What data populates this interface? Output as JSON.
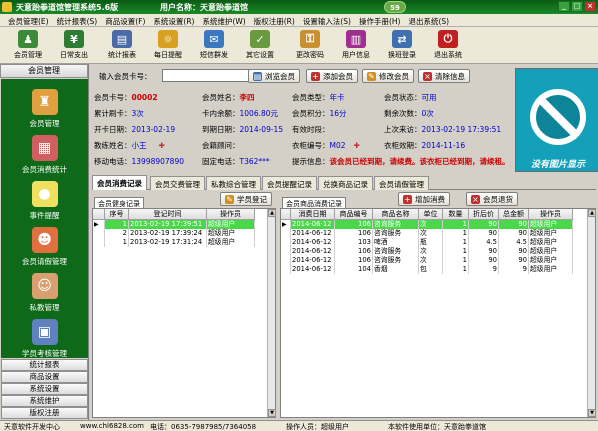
{
  "titlebar": {
    "title": "天意跆拳道馆管理系统5.6版",
    "user_label": "用户名称：天意跆拳道馆",
    "badge": "59",
    "min": "_",
    "max": "□",
    "close": "×"
  },
  "menu": [
    "会员管理(E)",
    "统计报表(S)",
    "商品设置(F)",
    "系统设置(R)",
    "系统维护(W)",
    "版权注册(R)",
    "设置输入法(S)",
    "操作手册(H)",
    "退出系统(S)"
  ],
  "toolbar": [
    {
      "label": "会员管理",
      "icon": "members-icon",
      "glyph": "♟",
      "color": "#3a8a3a"
    },
    {
      "label": "日常支出",
      "icon": "expense-icon",
      "glyph": "¥",
      "color": "#2e7d32"
    },
    {
      "label": "统计报表",
      "icon": "report-icon",
      "glyph": "▤",
      "color": "#4a6aa8"
    },
    {
      "label": "每日提醒",
      "icon": "reminder-icon",
      "glyph": "☼",
      "color": "#d8a020"
    },
    {
      "label": "短信群发",
      "icon": "sms-icon",
      "glyph": "✉",
      "color": "#3a78c0"
    },
    {
      "label": "其它设置",
      "icon": "settings-icon",
      "glyph": "✓",
      "color": "#6a9a40"
    },
    {
      "label": "更改密码",
      "icon": "password-icon",
      "glyph": "⚿",
      "color": "#c89030"
    },
    {
      "label": "用户信息",
      "icon": "user-info-icon",
      "glyph": "▥",
      "color": "#a03090"
    },
    {
      "label": "换班登录",
      "icon": "shift-login-icon",
      "glyph": "⇄",
      "color": "#4070b0"
    },
    {
      "label": "退出系统",
      "icon": "exit-icon",
      "glyph": "⏻",
      "color": "#c02020"
    }
  ],
  "sidebar": {
    "header": "会员管理",
    "items": [
      {
        "label": "会员管理",
        "icon": "member-manage-icon",
        "glyph": "♜",
        "color": "#e0a040"
      },
      {
        "label": "会员消费统计",
        "icon": "consume-stats-icon",
        "glyph": "▦",
        "color": "#d06060"
      },
      {
        "label": "事件提醒",
        "icon": "event-reminder-icon",
        "glyph": "●",
        "color": "#f0e060"
      },
      {
        "label": "会员请假管理",
        "icon": "leave-manage-icon",
        "glyph": "☻",
        "color": "#e07040"
      },
      {
        "label": "私教管理",
        "icon": "coach-manage-icon",
        "glyph": "☺",
        "color": "#d8a070"
      },
      {
        "label": "学员考核管理",
        "icon": "exam-manage-icon",
        "glyph": "▣",
        "color": "#6080c0"
      }
    ],
    "categories": [
      "统计报表",
      "商品设置",
      "系统设置",
      "系统维护",
      "版权注册"
    ]
  },
  "search": {
    "label": "输入会员卡号：",
    "value": "",
    "buttons": [
      {
        "label": "浏览会员",
        "icon": "browse-icon",
        "glyph": "▤",
        "color": "#3a70b0"
      },
      {
        "label": "添加会员",
        "icon": "add-icon",
        "glyph": "+",
        "color": "#c03030"
      },
      {
        "label": "修改会员",
        "icon": "edit-icon",
        "glyph": "✎",
        "color": "#d09020"
      },
      {
        "label": "清除信息",
        "icon": "clear-icon",
        "glyph": "×",
        "color": "#c03030"
      }
    ]
  },
  "member": {
    "rows": [
      [
        {
          "k": "会员卡号：",
          "v": "00002",
          "style": "red"
        },
        {
          "k": "会员姓名：",
          "v": "李四",
          "style": "red"
        },
        {
          "k": "会员类型：",
          "v": "年卡",
          "style": ""
        },
        {
          "k": "会员状态：",
          "v": "可用",
          "style": ""
        }
      ],
      [
        {
          "k": "累计刷卡：",
          "v": "3次",
          "style": ""
        },
        {
          "k": "卡内余额：",
          "v": "1006.80元",
          "style": ""
        },
        {
          "k": "会员积分：",
          "v": "16分",
          "style": ""
        },
        {
          "k": "剩余次数：",
          "v": "0次",
          "style": ""
        }
      ],
      [
        {
          "k": "开卡日期：",
          "v": "2013-02-19",
          "style": ""
        },
        {
          "k": "到期日期：",
          "v": "2014-09-15",
          "style": ""
        },
        {
          "k": "有效时段：",
          "v": "",
          "style": ""
        },
        {
          "k": "上次来访：",
          "v": "2013-02-19 17:39:51",
          "style": ""
        }
      ],
      [
        {
          "k": "教练姓名：",
          "v": "小王",
          "style": ""
        },
        {
          "k": "会籍顾问：",
          "v": "",
          "style": ""
        },
        {
          "k": "衣柜编号：",
          "v": "M02",
          "style": ""
        },
        {
          "k": "衣柜效期：",
          "v": "2014-11-16",
          "style": ""
        }
      ],
      [
        {
          "k": "移动电话：",
          "v": "13998907890",
          "style": ""
        },
        {
          "k": "固定电话：",
          "v": "T362***",
          "style": ""
        },
        {
          "k": "提示信息：",
          "v": "该会员已经到期，请续费。该衣柜已经到期，请续租。",
          "style": "red"
        }
      ]
    ]
  },
  "photo": {
    "text": "没有图片显示",
    "icon": "no-image-icon"
  },
  "tabs": [
    "会员消费记录",
    "会员交费管理",
    "私教综合管理",
    "会员提醒记录",
    "兑换商品记录",
    "会员请假管理"
  ],
  "left_panel": {
    "tab": "会员健身记录",
    "button": "学员登记",
    "columns": [
      "序号",
      "登记时间",
      "操作员"
    ],
    "rows": [
      [
        "1",
        "2013-02-19 17:39:51",
        "超级用户"
      ],
      [
        "2",
        "2013-02-19 17:39:24",
        "超级用户"
      ],
      [
        "1",
        "2013-02-19 17:31:24",
        "超级用户"
      ]
    ]
  },
  "right_panel": {
    "tab": "会员商品消费记录",
    "buttons": [
      "增加消费",
      "会员退货"
    ],
    "columns": [
      "消费日期",
      "商品编号",
      "商品名称",
      "单位",
      "数量",
      "折后价",
      "总金额",
      "操作员"
    ],
    "rows": [
      [
        "2014-06-12",
        "106",
        "咨询服务",
        "次",
        "1",
        "90",
        "90",
        "超级用户"
      ],
      [
        "2014-06-12",
        "106",
        "咨询服务",
        "次",
        "1",
        "90",
        "90",
        "超级用户"
      ],
      [
        "2014-06-12",
        "103",
        "啤酒",
        "瓶",
        "1",
        "4.5",
        "4.5",
        "超级用户"
      ],
      [
        "2014-06-12",
        "106",
        "咨询服务",
        "次",
        "1",
        "90",
        "90",
        "超级用户"
      ],
      [
        "2014-06-12",
        "106",
        "咨询服务",
        "次",
        "1",
        "90",
        "90",
        "超级用户"
      ],
      [
        "2014-06-12",
        "104",
        "香烟",
        "包",
        "1",
        "9",
        "9",
        "超级用户"
      ]
    ]
  },
  "status": {
    "company": "天意软件开发中心",
    "website": "www.chl6828.com",
    "phone": "电话：0635-7987985/7364058",
    "operator": "操作人员：超级用户",
    "licensee": "本软件使用单位：天意跆拳道馆"
  }
}
